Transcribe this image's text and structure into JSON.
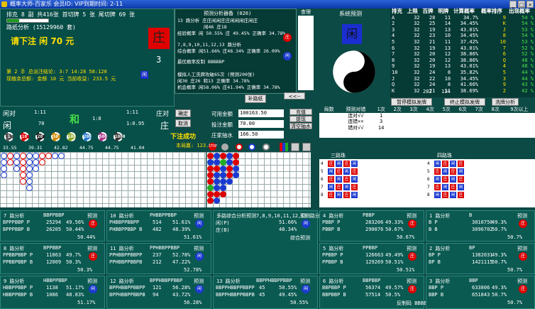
{
  "title": "概率大师-百家乐 会员ID:  VIP到期时间:  2-11",
  "top_stats": {
    "line1": "排克 8 副 共416张 首切牌 5 张 尾切牌 69 张",
    "line2": "路纸分析 (15129960 套)",
    "bet_text": "请下注 闲 70 元",
    "zhuang": "庄",
    "count": "3",
    "hand_info1": "第 2 手 总派注结论: 3:7 14:28 58:120",
    "hand_info2": "现植余总额: 金额 10 元 当前收益: 233.5 元"
  },
  "forecast": {
    "title": "预测分析器备 (026)",
    "lines": [
      "13 路分析 庄庄闲闲庄庄闲闲闲庄闲庄",
      "闲46 庄18",
      "经验概率 闲 50.55% 庄 49.45% 正确率 34.78%",
      "7,8,9,10,11,12,13 路分析",
      "综合概率 闲51.66% 庄48.34% 正确率 26.09%",
      "最优概率反制 BBBBBP",
      "模拟人工洗牌攻破65次 (预测200张)",
      "闲36 庄26 和13 正确率 34.78%",
      "机会概率 闲58.06% 庄41.94% 正确率 34.78%"
    ],
    "view_label": "查理",
    "btn_left": "补路纸",
    "btn_arrows": "<<--"
  },
  "system_predict": {
    "label": "系统预测",
    "symbol": "闲"
  },
  "pai_table": {
    "headers": [
      "排克",
      "上限",
      "百牌",
      "明牌",
      "计算概率",
      "概率排序",
      "出现概率"
    ],
    "rows": [
      [
        "A",
        "32",
        "28",
        "11",
        "34.7%",
        "9",
        "54 %"
      ],
      [
        "2",
        "32",
        "25",
        "14",
        "34.45%",
        "K",
        "54 %"
      ],
      [
        "3",
        "32",
        "19",
        "13",
        "43.01%",
        "J",
        "53 %"
      ],
      [
        "4",
        "32",
        "23",
        "10",
        "34.45%",
        "8",
        "54 %"
      ],
      [
        "5",
        "32",
        "21",
        "11",
        "37.42%",
        "10",
        "53 %"
      ],
      [
        "6",
        "32",
        "19",
        "13",
        "43.01%",
        "7",
        "52 %"
      ],
      [
        "7",
        "32",
        "20",
        "12",
        "38.86%",
        "6",
        "52 %"
      ],
      [
        "8",
        "32",
        "20",
        "12",
        "38.86%",
        "Q",
        "48 %"
      ],
      [
        "9",
        "32",
        "19",
        "13",
        "43.01%",
        "4",
        "48 %"
      ],
      [
        "10",
        "32",
        "24",
        "8",
        "35.82%",
        "5",
        "44 %"
      ],
      [
        "J",
        "32",
        "22",
        "10",
        "34.45%",
        "3",
        "44 %"
      ],
      [
        "Q",
        "32",
        "24",
        "8",
        "41.66%",
        "9",
        "43 %"
      ],
      [
        "K",
        "32",
        "21",
        "11",
        "38.69%",
        "2",
        "42 %"
      ]
    ],
    "totals": [
      "282",
      "134"
    ],
    "btn1": "暂停模拟发牌",
    "btn2": "终止模拟发牌",
    "btn3": "洗牌分析"
  },
  "bet_area": {
    "xian_dui": "闲对",
    "xian_dui_val": "1:11",
    "xian": "闲",
    "xian_val": "70",
    "he": "和",
    "he_val": "1:8",
    "zhuang_dui_val": "1:11",
    "zhuang_dui": "庄对",
    "zhuang_val": "1:0.95",
    "zhuang": "庄",
    "btn_confirm": "确定",
    "btn_cancel": "取消",
    "win_text": "下注成功",
    "round_win": "本局赢: 123.5",
    "chips": [
      "1",
      "10",
      "20",
      "50",
      "100",
      "200",
      "500",
      "1000"
    ],
    "chip_vals": [
      "33.55",
      "39.31",
      "42.82",
      "44.75",
      "44.75",
      "41.04"
    ]
  },
  "money": {
    "avail_label": "可用金额",
    "avail_val": "100163.50",
    "bet_label": "投注金额",
    "bet_val": "70.00",
    "pump_label": "庄家抽水",
    "pump_val": "166.50",
    "btn1": "充值",
    "btn2": "提现",
    "btn3": "清空抽水"
  },
  "round_table": {
    "headers": [
      "局数",
      "预测对错",
      "1次",
      "2次",
      "3次",
      "4次",
      "5次",
      "6次",
      "7次",
      "8次",
      "9次以上"
    ],
    "rows": [
      [
        "连对√√",
        "1",
        "",
        "",
        "",
        "",
        "",
        "",
        "",
        ""
      ],
      [
        "连错××",
        "3",
        "",
        "",
        "",
        "",
        "",
        "",
        "",
        ""
      ],
      [
        "错对√√",
        "14",
        "",
        "",
        "",
        "",
        "",
        "",
        "",
        ""
      ]
    ]
  },
  "road3": {
    "title": "三路珠"
  },
  "road4": {
    "title": "四路珠"
  },
  "analyses": [
    {
      "name": "7 路分析",
      "seq": "BBPPBBP",
      "p1": "BPPPBBP P",
      "v1": "25294",
      "pc1": "49.56%",
      "p2": "BPPPBBP B",
      "v2": "26205",
      "pc2": "50.44%",
      "pick": "庄",
      "foot": "50.44%"
    },
    {
      "name": "10 路分析",
      "seq": "PHBBPPBBP",
      "p1": "PHBBPPBBPP",
      "v1": "514",
      "pc1": "51.61%",
      "p2": "PHBBPPBBP B",
      "v2": "482",
      "pc2": "48.39%",
      "pick": "闲",
      "foot": "51.61%"
    },
    {
      "name": "多路综合分析预测",
      "seq": "7,8,9,10,11,12,13 路分析",
      "p1": "闲(P)",
      "v1": "",
      "pc1": "51.66%",
      "p2": "庄(B)",
      "v2": "",
      "pc2": "48.34%",
      "pick": "闲",
      "foot": "综合预测"
    },
    {
      "name": "4 路分析",
      "seq": "PBBP",
      "p1": "PBBP P",
      "v1": "283206",
      "pc1": "49.33%",
      "p2": "PBBP B",
      "v2": "290876",
      "pc2": "50.67%",
      "pick": "庄",
      "foot": "50.67%"
    },
    {
      "name": "1 路分析",
      "seq": "B",
      "p1": "B P",
      "v1": "3010750",
      "pc1": "49.3%",
      "p2": "B B",
      "v2": "3096702",
      "pc2": "50.7%",
      "pick": "庄",
      "foot": "50.7%"
    },
    {
      "name": "8 路分析",
      "seq": "BPPBBP",
      "p1": "PPBBPBBP P",
      "v1": "11863",
      "pc1": "49.7%",
      "p2": "PPBBPBBP B",
      "v2": "12009",
      "pc2": "50.3%",
      "pick": "庄",
      "foot": "50.3%"
    },
    {
      "name": "11 路分析",
      "seq": "PPHBBPPBBP",
      "p1": "PPHBBPPBBPP",
      "v1": "237",
      "pc1": "52.78%",
      "p2": "PPHBBPPBBPB",
      "v2": "212",
      "pc2": "47.22%",
      "pick": "闲",
      "foot": "52.78%"
    },
    {
      "name": "5 路分析",
      "seq": "PPBBP",
      "p1": "PPBBP P",
      "v1": "126663",
      "pc1": "49.49%",
      "p2": "PPBBP B",
      "v2": "129269",
      "pc2": "50.51%",
      "pick": "庄",
      "foot": "50.51%"
    },
    {
      "name": "2 路分析",
      "seq": "BP",
      "p1": "BP P",
      "v1": "1382031",
      "pc1": "49.3%",
      "p2": "BP B",
      "v2": "1421115",
      "pc2": "50.7%",
      "pick": "庄",
      "foot": "50.7%"
    },
    {
      "name": "9 路分析",
      "seq": "HBBPPBBP",
      "p1": "HBBPPBBP P",
      "v1": "1138",
      "pc1": "51.17%",
      "p2": "HBBPPBBP B",
      "v2": "1086",
      "pc2": "48.83%",
      "pick": "闲",
      "foot": "51.17%"
    },
    {
      "name": "12 路分析",
      "seq": "BPPHBBPPBBP",
      "p1": "BPPHBBPPBBPP",
      "v1": "121",
      "pc1": "56.28%",
      "p2": "BPPHBBPPBBPB",
      "v2": "94",
      "pc2": "43.72%",
      "pick": "闲",
      "foot": "56.28%"
    },
    {
      "name": "13 路分析",
      "seq": "BBPPHBBPPBBP",
      "p1": "BBPPHBBPPBBPP",
      "v1": "45",
      "pc1": "50.55%",
      "p2": "BBPPHBBPPBBPB",
      "v2": "45",
      "pc2": "49.45%",
      "pick": "闲",
      "foot": "50.55%"
    },
    {
      "name": "6 路分析",
      "seq": "BBPBBP",
      "p1": "BBPBBP P",
      "v1": "56374",
      "pc1": "49.57%",
      "p2": "BBPBBP B",
      "v2": "57514",
      "pc2": "50.5%",
      "pick": "庄",
      "foot": "反制码 BBBBBP"
    },
    {
      "name": "3 路分析",
      "seq": "BBP",
      "p1": "BBP P",
      "v1": "633806",
      "pc1": "49.3%",
      "p2": "BBP B",
      "v2": "651843",
      "pc2": "50.7%",
      "pick": "庄",
      "foot": "50.7%"
    }
  ]
}
